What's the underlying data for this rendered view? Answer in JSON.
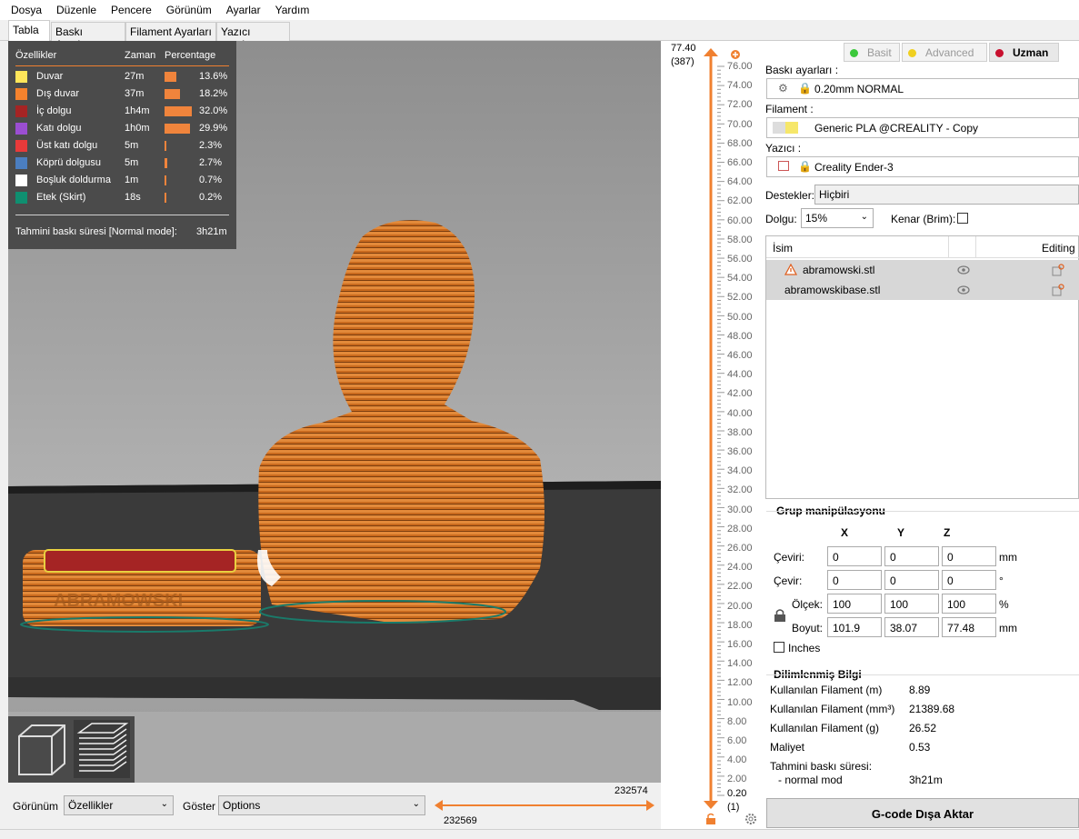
{
  "menu": [
    "Dosya",
    "Düzenle",
    "Pencere",
    "Görünüm",
    "Ayarlar",
    "Yardım"
  ],
  "tabs": [
    "Tabla",
    "Baskı Ayarları",
    "Filament Ayarları",
    "Yazıcı ayarları"
  ],
  "legend": {
    "header": {
      "feature": "Özellikler",
      "time": "Zaman",
      "percentage": "Percentage"
    },
    "rows": [
      {
        "name": "Duvar",
        "time": "27m",
        "percent": "13.6%",
        "fraction": 0.136,
        "color": "#ffe65a"
      },
      {
        "name": "Dış duvar",
        "time": "37m",
        "percent": "18.2%",
        "fraction": 0.182,
        "color": "#f5822d"
      },
      {
        "name": "İç dolgu",
        "time": "1h4m",
        "percent": "32.0%",
        "fraction": 0.32,
        "color": "#a52424"
      },
      {
        "name": "Katı dolgu",
        "time": "1h0m",
        "percent": "29.9%",
        "fraction": 0.299,
        "color": "#9b4ed2"
      },
      {
        "name": "Üst katı dolgu",
        "time": "5m",
        "percent": "2.3%",
        "fraction": 0.023,
        "color": "#e83a3a"
      },
      {
        "name": "Köprü dolgusu",
        "time": "5m",
        "percent": "2.7%",
        "fraction": 0.027,
        "color": "#4b7ec0"
      },
      {
        "name": "Boşluk doldurma",
        "time": "1m",
        "percent": "0.7%",
        "fraction": 0.007,
        "color": "#ffffff"
      },
      {
        "name": "Etek (Skirt)",
        "time": "18s",
        "percent": "0.2%",
        "fraction": 0.002,
        "color": "#0f8f70"
      }
    ],
    "total_label": "Tahmini baskı süresi [Normal mode]:",
    "total_value": "3h21m"
  },
  "bottom": {
    "view_label": "Görünüm",
    "view_value": "Özellikler",
    "show_label": "Göster",
    "show_value": "Options",
    "h_slider_left": "232569",
    "h_slider_right": "232574"
  },
  "vslider": {
    "top_value": "77.40",
    "top_layer": "(387)",
    "bottom_value": "0.20",
    "bottom_layer": "(1)",
    "ticks": [
      "76.00",
      "74.00",
      "72.00",
      "70.00",
      "68.00",
      "66.00",
      "64.00",
      "62.00",
      "60.00",
      "58.00",
      "56.00",
      "54.00",
      "52.00",
      "50.00",
      "48.00",
      "46.00",
      "44.00",
      "42.00",
      "40.00",
      "38.00",
      "36.00",
      "34.00",
      "32.00",
      "30.00",
      "28.00",
      "26.00",
      "24.00",
      "22.00",
      "20.00",
      "18.00",
      "16.00",
      "14.00",
      "12.00",
      "10.00",
      "8.00",
      "6.00",
      "4.00",
      "2.00"
    ]
  },
  "modes": [
    {
      "label": "Basit",
      "color": "#3cc83c",
      "active": false
    },
    {
      "label": "Advanced",
      "color": "#f0d020",
      "active": false
    },
    {
      "label": "Uzman",
      "color": "#c8102e",
      "active": true
    }
  ],
  "print_settings": {
    "label": "Baskı ayarları :",
    "value": "0.20mm NORMAL"
  },
  "filament": {
    "label": "Filament :",
    "value": "Generic PLA @CREALITY - Copy"
  },
  "printer": {
    "label": "Yazıcı :",
    "value": "Creality Ender-3"
  },
  "supports": {
    "label": "Destekler:",
    "value": "Hiçbiri"
  },
  "infill": {
    "label": "Dolgu:",
    "value": "15%"
  },
  "brim": {
    "label": "Kenar (Brim):",
    "checked": false
  },
  "objects": {
    "col_name": "İsim",
    "col_editing": "Editing",
    "items": [
      {
        "name": "abramowski.stl",
        "warning": true
      },
      {
        "name": "abramowskibase.stl",
        "warning": false
      }
    ]
  },
  "manipulation": {
    "title": "Grup manipülasyonu",
    "axes": [
      "X",
      "Y",
      "Z"
    ],
    "rows": [
      {
        "label": "Çeviri:",
        "values": [
          "0",
          "0",
          "0"
        ],
        "unit": "mm"
      },
      {
        "label": "Çevir:",
        "values": [
          "0",
          "0",
          "0"
        ],
        "unit": "°"
      },
      {
        "label": "Ölçek:",
        "values": [
          "100",
          "100",
          "100"
        ],
        "unit": "%"
      },
      {
        "label": "Boyut:",
        "values": [
          "101.9",
          "38.07",
          "77.48"
        ],
        "unit": "mm"
      }
    ],
    "inches_label": "Inches"
  },
  "sliced_info": {
    "title": "Dilimlenmiş Bilgi",
    "rows": [
      {
        "label": "Kullanılan Filament (m)",
        "value": "8.89"
      },
      {
        "label": "Kullanılan Filament (mm³)",
        "value": "21389.68"
      },
      {
        "label": "Kullanılan Filament (g)",
        "value": "26.52"
      },
      {
        "label": "Maliyet",
        "value": "0.53"
      }
    ],
    "time_label": "Tahmini baskı süresi:",
    "mode_label": "- normal mod",
    "mode_value": "3h21m"
  },
  "export_label": "G-code Dışa Aktar"
}
